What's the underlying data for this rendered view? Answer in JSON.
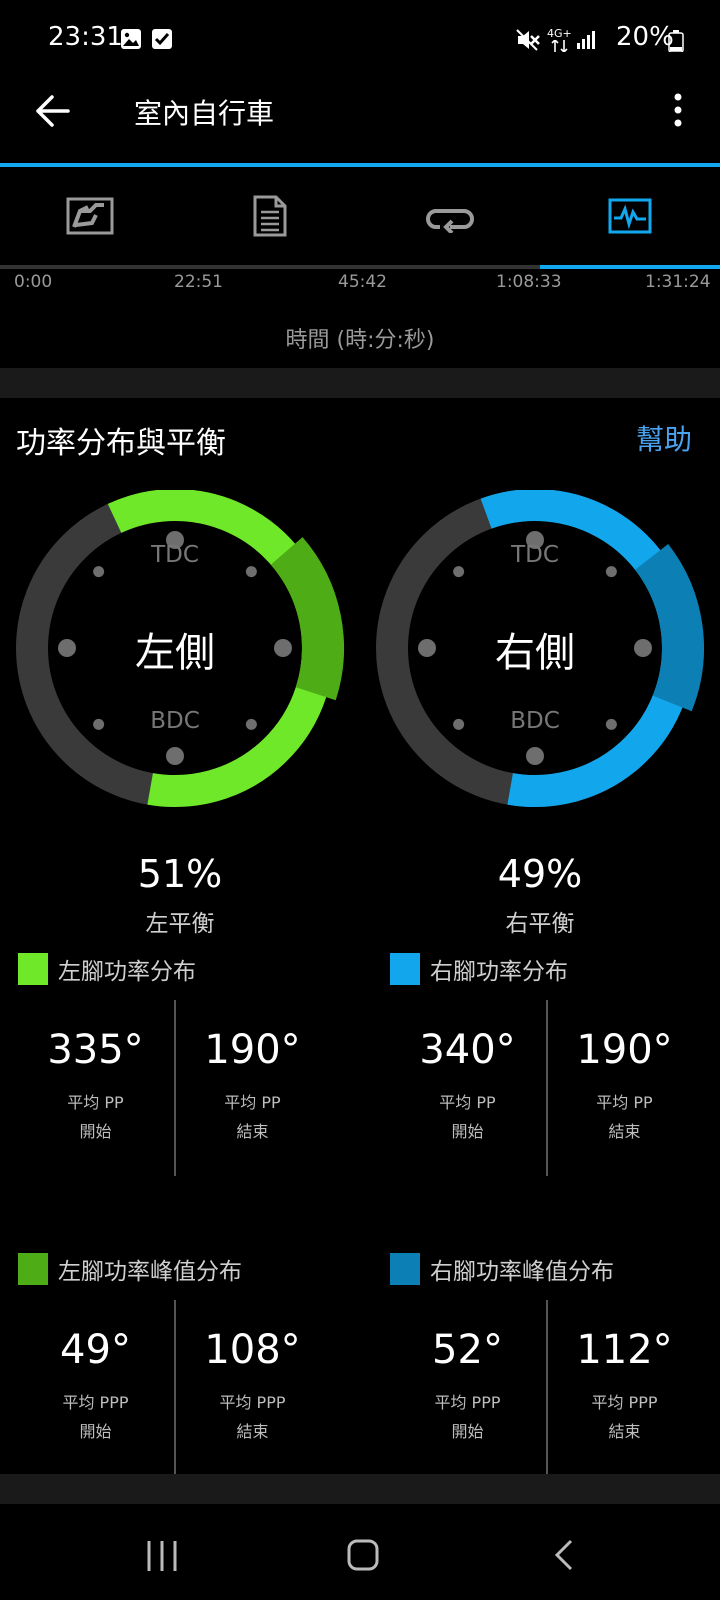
{
  "status_bar": {
    "time": "23:31",
    "battery": "20%",
    "network": "4G+"
  },
  "app_bar": {
    "title": "室內自行車"
  },
  "tabs": [
    {
      "name": "map-chart-icon"
    },
    {
      "name": "document-icon"
    },
    {
      "name": "laps-icon"
    },
    {
      "name": "activity-chart-icon",
      "active": true
    }
  ],
  "timeline": {
    "ticks": [
      "0:00",
      "22:51",
      "45:42",
      "1:08:33",
      "1:31:24"
    ],
    "axis_title": "時間 (時:分:秒)"
  },
  "section": {
    "title": "功率分布與平衡",
    "help_label": "幫助"
  },
  "colors": {
    "accent": "#11a8ef",
    "left": "#6fe82a",
    "left_peak": "#4ead16",
    "right": "#12a7ec",
    "right_peak": "#0c7fb5",
    "track": "#3a3a3a"
  },
  "left": {
    "center_label": "左側",
    "tdc": "TDC",
    "bdc": "BDC",
    "balance_pct": "51%",
    "balance_label": "左平衡",
    "pp_arc_deg": {
      "start": 335,
      "end": 190
    },
    "ppp_arc_deg": {
      "start": 49,
      "end": 108
    },
    "pp_header": "左腳功率分布",
    "ppp_header": "左腳功率峰值分布",
    "pp_start": "335°",
    "pp_end": "190°",
    "ppp_start": "49°",
    "ppp_end": "108°"
  },
  "right": {
    "center_label": "右側",
    "tdc": "TDC",
    "bdc": "BDC",
    "balance_pct": "49%",
    "balance_label": "右平衡",
    "pp_arc_deg": {
      "start": 340,
      "end": 190
    },
    "ppp_arc_deg": {
      "start": 52,
      "end": 112
    },
    "pp_header": "右腳功率分布",
    "ppp_header": "右腳功率峰值分布",
    "pp_start": "340°",
    "pp_end": "190°",
    "ppp_start": "52°",
    "ppp_end": "112°"
  },
  "labels": {
    "avg_pp": "平均 PP",
    "avg_ppp": "平均 PPP",
    "start": "開始",
    "end": "結束"
  }
}
